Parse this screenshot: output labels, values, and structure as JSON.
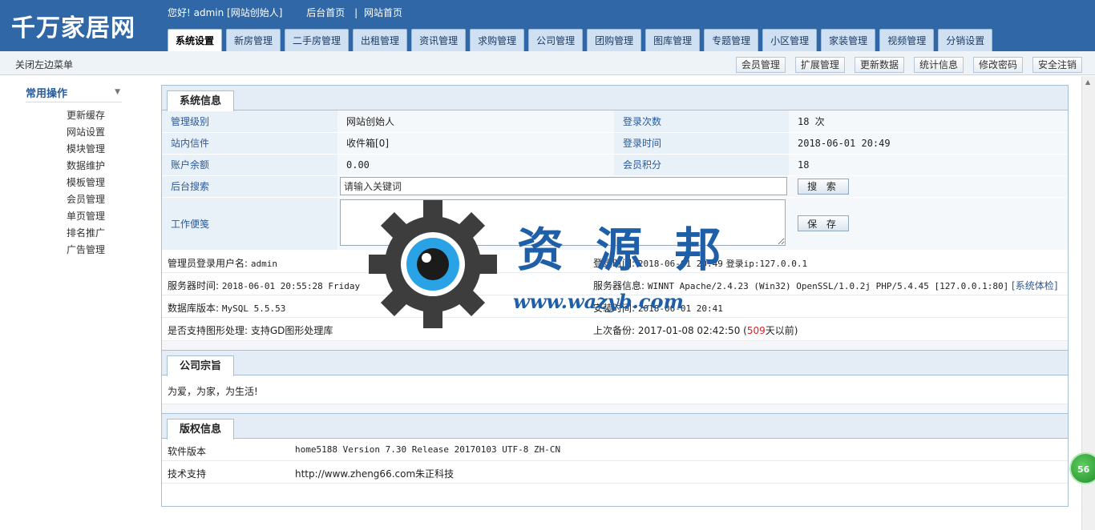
{
  "header": {
    "logo": "千万家居网",
    "welcome": "您好! admin [网站创始人]",
    "links": [
      "后台首页",
      "网站首页"
    ],
    "tabs": [
      "系统设置",
      "新房管理",
      "二手房管理",
      "出租管理",
      "资讯管理",
      "求购管理",
      "公司管理",
      "团购管理",
      "图库管理",
      "专题管理",
      "小区管理",
      "家装管理",
      "视频管理",
      "分销设置"
    ],
    "active_tab": "系统设置"
  },
  "subbar": {
    "close_menu": "关闭左边菜单",
    "buttons": [
      "会员管理",
      "扩展管理",
      "更新数据",
      "统计信息",
      "修改密码",
      "安全注销"
    ]
  },
  "sidebar": {
    "title": "常用操作",
    "items": [
      "更新缓存",
      "网站设置",
      "模块管理",
      "数据维护",
      "模板管理",
      "会员管理",
      "单页管理",
      "排名推广",
      "广告管理"
    ]
  },
  "system_info": {
    "title": "系统信息",
    "rows": [
      {
        "l1": "管理级别",
        "v1": "网站创始人",
        "l2": "登录次数",
        "v2": "18 次"
      },
      {
        "l1": "站内信件",
        "v1": "收件箱[0]",
        "l2": "登录时间",
        "v2": "2018-06-01 20:49"
      },
      {
        "l1": "账户余额",
        "v1": "0.00",
        "l2": "会员积分",
        "v2": "18"
      }
    ],
    "search_label": "后台搜索",
    "search_placeholder": "请输入关键词",
    "search_button": "搜 索",
    "memo_label": "工作便笺",
    "save_button": "保 存",
    "details": {
      "admin_user_label": "管理员登录用户名:",
      "admin_user": "admin",
      "login_time_label": "登录时间:",
      "login_time": "2018-06-01 20:49",
      "login_ip_label": "登录ip:",
      "login_ip": "127.0.0.1",
      "server_time_label": "服务器时间:",
      "server_time": "2018-06-01 20:55:28 Friday",
      "server_info_label": "服务器信息:",
      "server_info": "WINNT Apache/2.4.23 (Win32) OpenSSL/1.0.2j PHP/5.4.45 [127.0.0.1:80]",
      "server_check_link": "[系统体检]",
      "db_version_label": "数据库版本:",
      "db_version": "MySQL 5.5.53",
      "install_time_label": "安装时间:",
      "install_time": "2018-06-01 20:41",
      "gd_label": "是否支持图形处理:",
      "gd_value": "支持GD图形处理库",
      "backup_label": "上次备份:",
      "backup_time": "2017-01-08 02:42:50",
      "backup_days": "509",
      "backup_suffix": "天以前)"
    }
  },
  "mission": {
    "title": "公司宗旨",
    "text": "为爱，为家，为生活!"
  },
  "copyright": {
    "title": "版权信息",
    "version_label": "软件版本",
    "version": "home5188 Version 7.30 Release 20170103 UTF-8 ZH-CN",
    "support_label": "技术支持",
    "support": "http://www.zheng66.com朱正科技"
  },
  "watermark": {
    "text": "资 源 邦",
    "url": "www.wazyb.com"
  },
  "float_badge": "56"
}
